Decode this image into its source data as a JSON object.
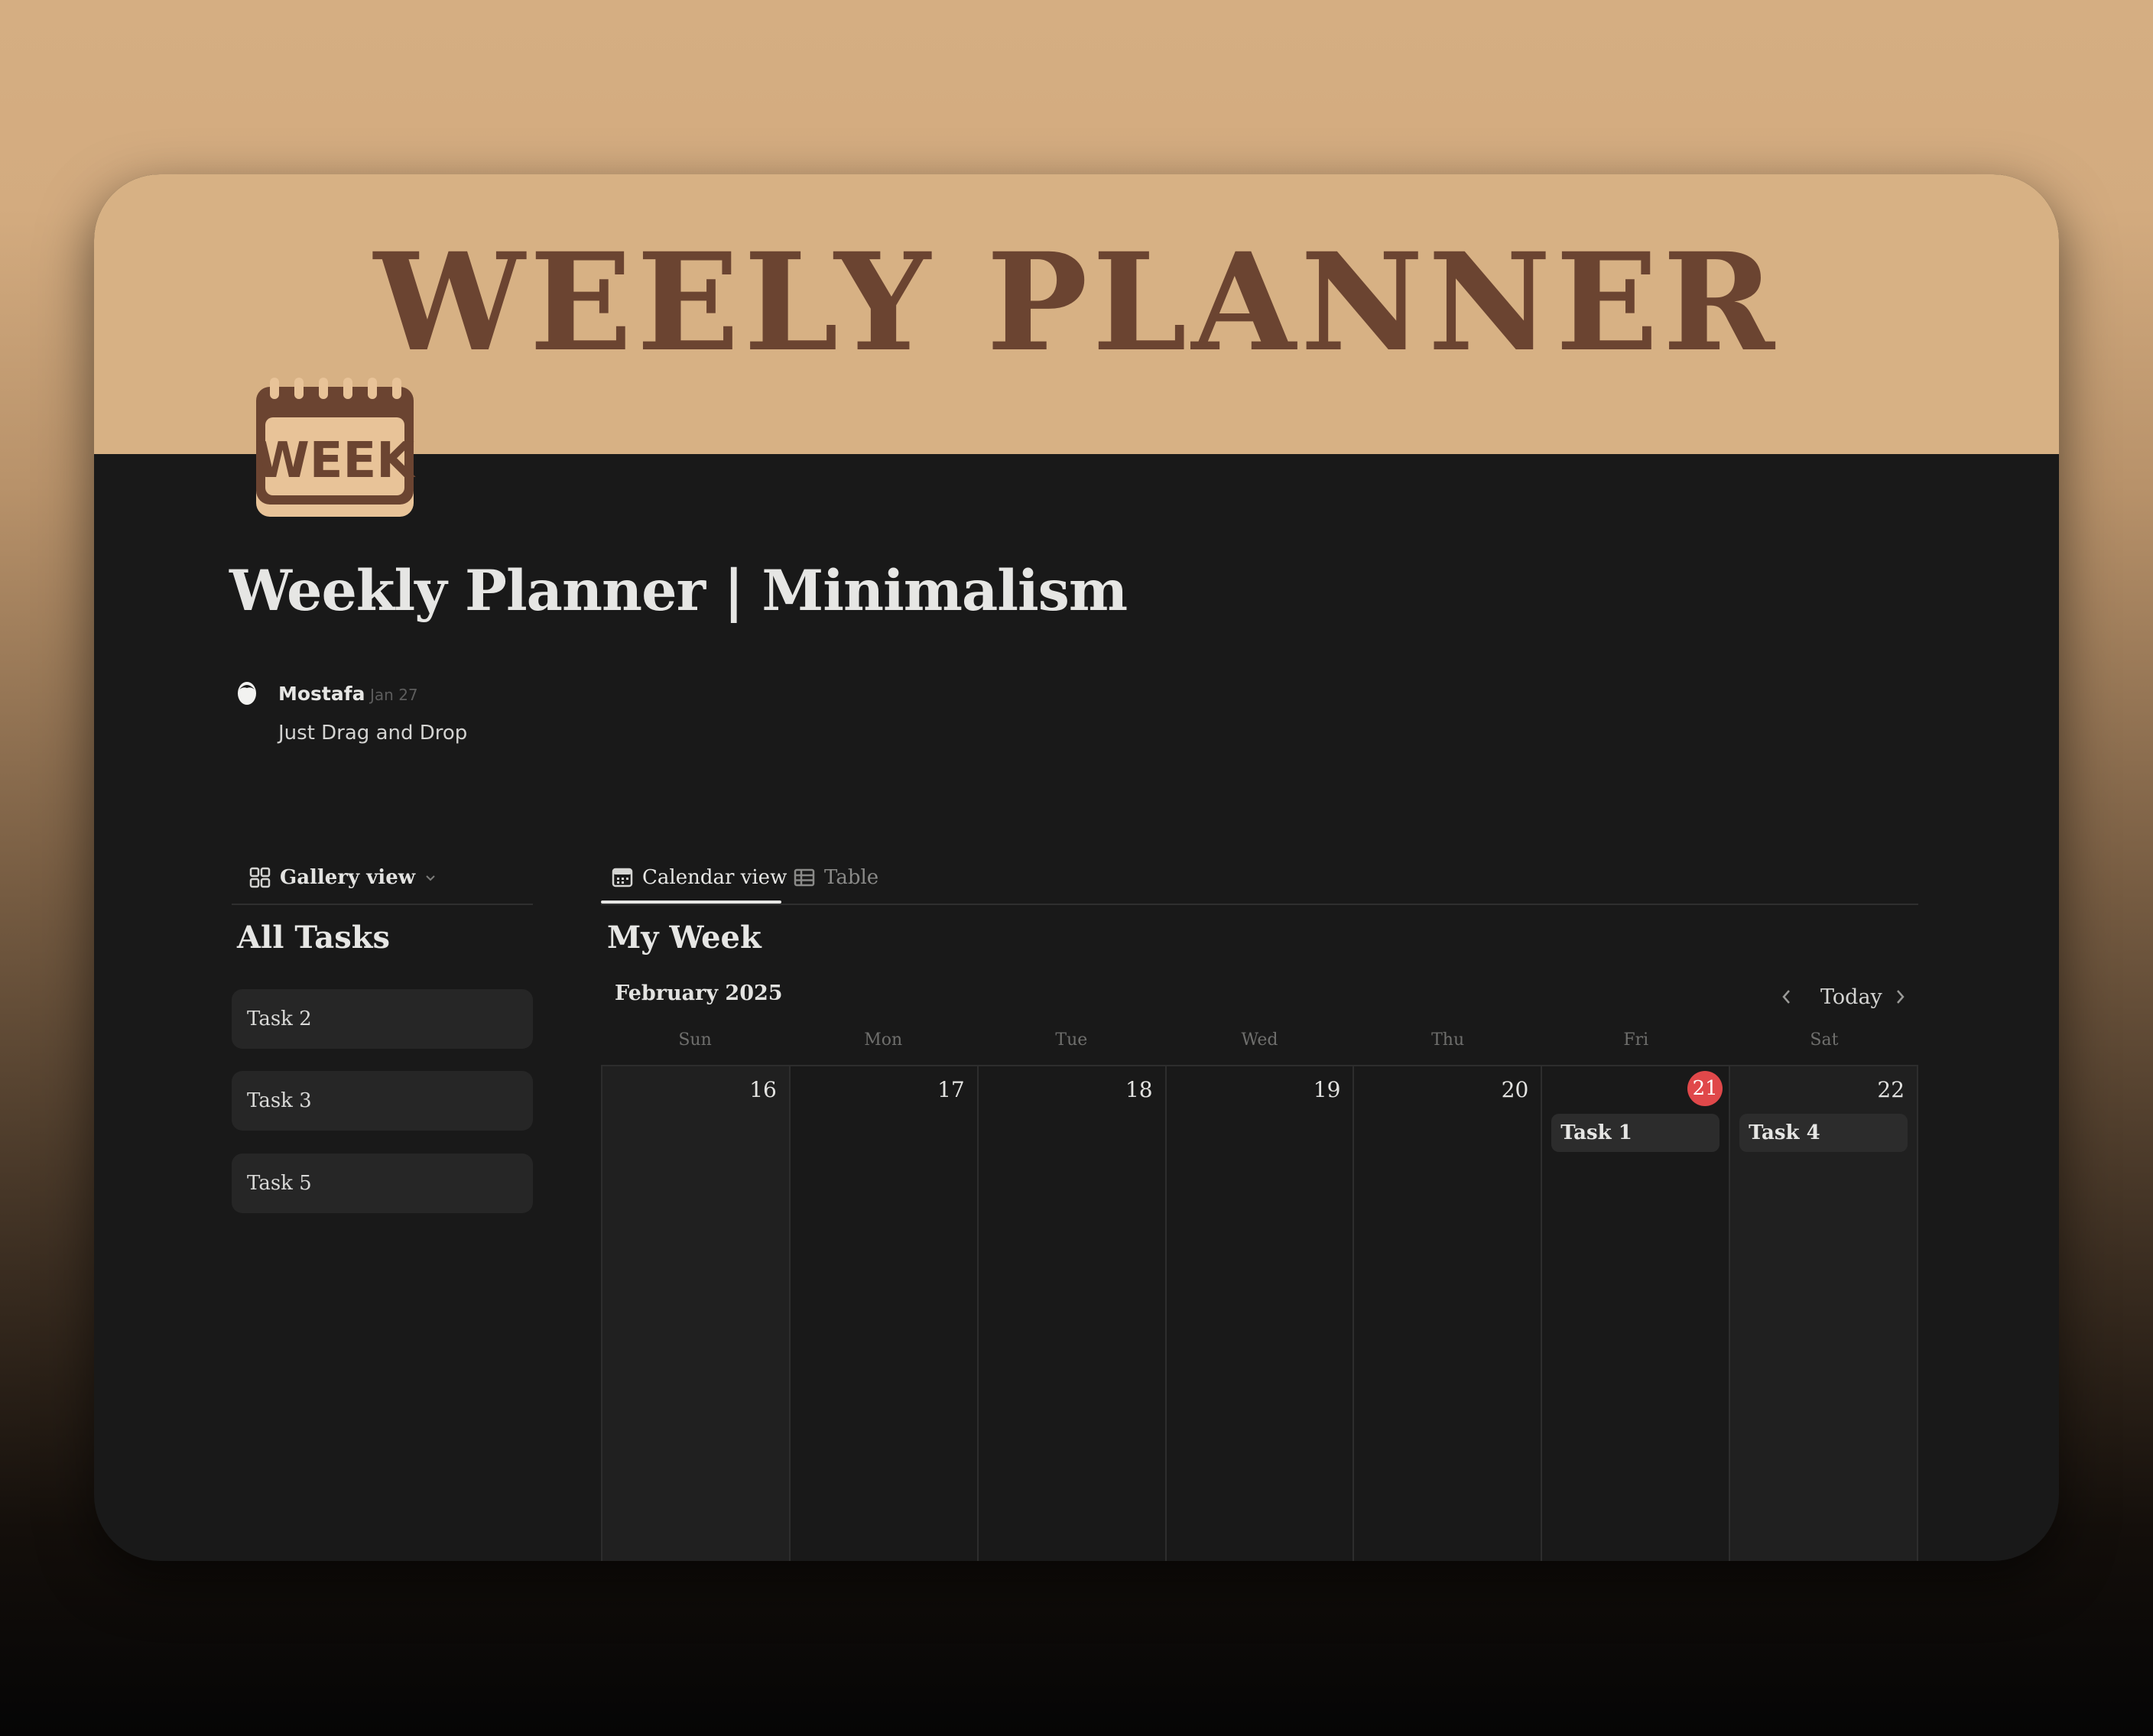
{
  "cover": {
    "title": "WEELY PLANNER"
  },
  "page": {
    "icon": "week-calendar-icon",
    "icon_text": "WEEK",
    "title": "Weekly Planner | Minimalism"
  },
  "comment": {
    "author": "Mostafa",
    "date": "Jan 27",
    "text": "Just Drag and Drop"
  },
  "gallery": {
    "view_label": "Gallery view",
    "title": "All Tasks",
    "cards": [
      {
        "label": "Task 2"
      },
      {
        "label": "Task 3"
      },
      {
        "label": "Task 5"
      }
    ]
  },
  "calendar": {
    "tabs": [
      {
        "label": "Calendar view",
        "active": true
      },
      {
        "label": "Table",
        "active": false
      }
    ],
    "title": "My Week",
    "month": "February 2025",
    "today_label": "Today",
    "weekdays": [
      "Sun",
      "Mon",
      "Tue",
      "Wed",
      "Thu",
      "Fri",
      "Sat"
    ],
    "days": [
      {
        "num": "16",
        "event": ""
      },
      {
        "num": "17",
        "event": ""
      },
      {
        "num": "18",
        "event": ""
      },
      {
        "num": "19",
        "event": ""
      },
      {
        "num": "20",
        "event": ""
      },
      {
        "num": "21",
        "event": "Task 1",
        "today": true
      },
      {
        "num": "22",
        "event": "Task 4"
      }
    ]
  },
  "colors": {
    "cover_bg": "#d7b184",
    "cover_text": "#6b4431",
    "page_bg": "#191919",
    "today_badge": "#e0484a"
  }
}
